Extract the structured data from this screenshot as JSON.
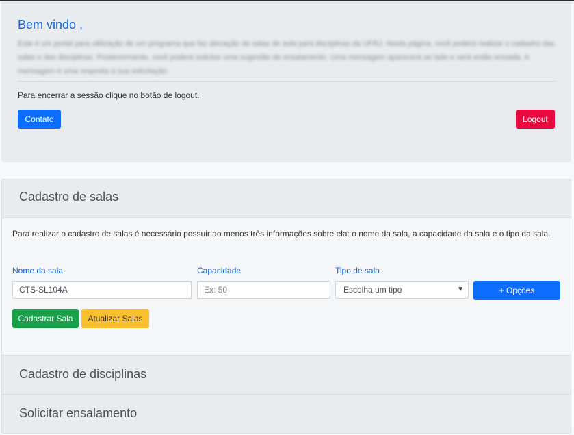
{
  "welcome": {
    "title": "Bem vindo ,",
    "description": "Este é um portal para utilização de um programa que faz alocação de salas de aula para disciplinas da UFRJ. Nesta página, você poderá realizar o cadastro das salas e das disciplinas. Posteriormente, você poderá solicitar uma sugestão de ensalamento. Uma mensagem aparecerá ao lado e será então enviada. A mensagem é uma resposta à sua solicitação.",
    "logout_note": "Para encerrar a sessão clique no botão de logout.",
    "contato_label": "Contato",
    "logout_label": "Logout"
  },
  "cadastro_salas": {
    "header": "Cadastro de salas",
    "description": "Para realizar o cadastro de salas é necessário possuir ao menos três informações sobre ela: o nome da sala, a capacidade da sala e o tipo da sala.",
    "nome_label": "Nome da sala",
    "nome_value": "CTS-SL104A",
    "capacidade_label": "Capacidade",
    "capacidade_placeholder": "Ex: 50",
    "tipo_label": "Tipo de sala",
    "tipo_selected": "Escolha um tipo",
    "opcoes_label": "+ Opções",
    "cadastrar_label": "Cadastrar Sala",
    "atualizar_label": "Atualizar Salas"
  },
  "cadastro_disciplinas": {
    "header": "Cadastro de disciplinas"
  },
  "solicitar": {
    "header": "Solicitar ensalamento"
  },
  "colors": {
    "primary": "#0d6efd",
    "danger": "#e8093f",
    "success": "#18a04a",
    "warning": "#fbc02d",
    "title_blue": "#1565d8"
  }
}
